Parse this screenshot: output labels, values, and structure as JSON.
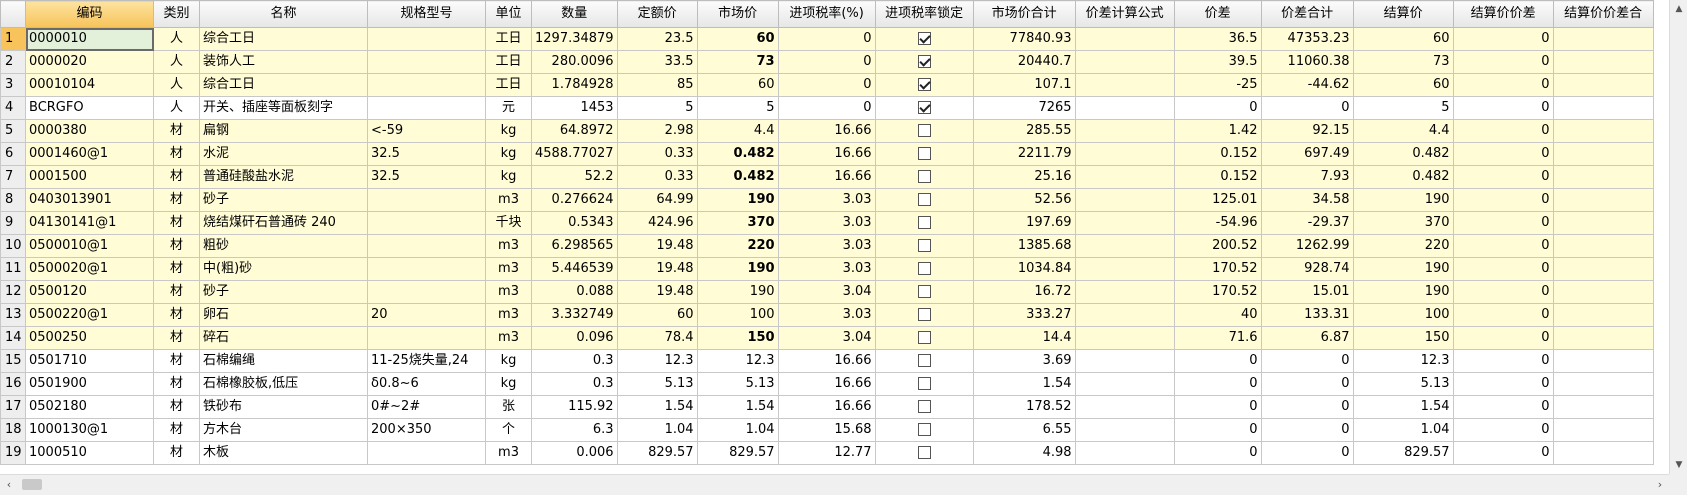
{
  "columns": [
    "",
    "编码",
    "类别",
    "名称",
    "规格型号",
    "单位",
    "数量",
    "定额价",
    "市场价",
    "进项税率(%)",
    "进项税率锁定",
    "市场价合计",
    "价差计算公式",
    "价差",
    "价差合计",
    "结算价",
    "结算价价差",
    "结算价价差合"
  ],
  "sorted_column": 1,
  "rows": [
    {
      "n": "1",
      "code": "0000010",
      "cat": "人",
      "name": "综合工日",
      "spec": "",
      "unit": "工日",
      "qty": "1297.34879",
      "quota": "23.5",
      "market": "60",
      "mb": true,
      "tax": "0",
      "lock": true,
      "mtotal": "77840.93",
      "formula": "",
      "diff": "36.5",
      "difftotal": "47353.23",
      "settle": "60",
      "sdiff": "0",
      "sdifftotal": "",
      "bg": "yellow"
    },
    {
      "n": "2",
      "code": "0000020",
      "cat": "人",
      "name": "装饰人工",
      "spec": "",
      "unit": "工日",
      "qty": "280.0096",
      "quota": "33.5",
      "market": "73",
      "mb": true,
      "tax": "0",
      "lock": true,
      "mtotal": "20440.7",
      "formula": "",
      "diff": "39.5",
      "difftotal": "11060.38",
      "settle": "73",
      "sdiff": "0",
      "sdifftotal": "",
      "bg": "yellow"
    },
    {
      "n": "3",
      "code": "00010104",
      "cat": "人",
      "name": "综合工日",
      "spec": "",
      "unit": "工日",
      "qty": "1.784928",
      "quota": "85",
      "market": "60",
      "mb": false,
      "tax": "0",
      "lock": true,
      "mtotal": "107.1",
      "formula": "",
      "diff": "-25",
      "difftotal": "-44.62",
      "settle": "60",
      "sdiff": "0",
      "sdifftotal": "",
      "bg": "yellow"
    },
    {
      "n": "4",
      "code": "BCRGFO",
      "cat": "人",
      "name": "开关、插座等面板刻字",
      "spec": "",
      "unit": "元",
      "qty": "1453",
      "quota": "5",
      "market": "5",
      "mb": false,
      "tax": "0",
      "lock": true,
      "mtotal": "7265",
      "formula": "",
      "diff": "0",
      "difftotal": "0",
      "settle": "5",
      "sdiff": "0",
      "sdifftotal": "",
      "bg": "white"
    },
    {
      "n": "5",
      "code": "0000380",
      "cat": "材",
      "name": "扁钢",
      "spec": "<-59",
      "unit": "kg",
      "qty": "64.8972",
      "quota": "2.98",
      "market": "4.4",
      "mb": false,
      "tax": "16.66",
      "lock": false,
      "mtotal": "285.55",
      "formula": "",
      "diff": "1.42",
      "difftotal": "92.15",
      "settle": "4.4",
      "sdiff": "0",
      "sdifftotal": "",
      "bg": "yellow"
    },
    {
      "n": "6",
      "code": "0001460@1",
      "cat": "材",
      "name": "水泥",
      "spec": "32.5",
      "unit": "kg",
      "qty": "4588.77027",
      "quota": "0.33",
      "market": "0.482",
      "mb": true,
      "tax": "16.66",
      "lock": false,
      "mtotal": "2211.79",
      "formula": "",
      "diff": "0.152",
      "difftotal": "697.49",
      "settle": "0.482",
      "sdiff": "0",
      "sdifftotal": "",
      "bg": "yellow"
    },
    {
      "n": "7",
      "code": "0001500",
      "cat": "材",
      "name": "普通硅酸盐水泥",
      "spec": "32.5",
      "unit": "kg",
      "qty": "52.2",
      "quota": "0.33",
      "market": "0.482",
      "mb": true,
      "tax": "16.66",
      "lock": false,
      "mtotal": "25.16",
      "formula": "",
      "diff": "0.152",
      "difftotal": "7.93",
      "settle": "0.482",
      "sdiff": "0",
      "sdifftotal": "",
      "bg": "yellow"
    },
    {
      "n": "8",
      "code": "0403013901",
      "cat": "材",
      "name": "砂子",
      "spec": "",
      "unit": "m3",
      "qty": "0.276624",
      "quota": "64.99",
      "market": "190",
      "mb": true,
      "tax": "3.03",
      "lock": false,
      "mtotal": "52.56",
      "formula": "",
      "diff": "125.01",
      "difftotal": "34.58",
      "settle": "190",
      "sdiff": "0",
      "sdifftotal": "",
      "bg": "yellow"
    },
    {
      "n": "9",
      "code": "04130141@1",
      "cat": "材",
      "name": "烧结煤矸石普通砖 240",
      "spec": "",
      "unit": "千块",
      "qty": "0.5343",
      "quota": "424.96",
      "market": "370",
      "mb": true,
      "tax": "3.03",
      "lock": false,
      "mtotal": "197.69",
      "formula": "",
      "diff": "-54.96",
      "difftotal": "-29.37",
      "settle": "370",
      "sdiff": "0",
      "sdifftotal": "",
      "bg": "yellow"
    },
    {
      "n": "10",
      "code": "0500010@1",
      "cat": "材",
      "name": "粗砂",
      "spec": "",
      "unit": "m3",
      "qty": "6.298565",
      "quota": "19.48",
      "market": "220",
      "mb": true,
      "tax": "3.03",
      "lock": false,
      "mtotal": "1385.68",
      "formula": "",
      "diff": "200.52",
      "difftotal": "1262.99",
      "settle": "220",
      "sdiff": "0",
      "sdifftotal": "",
      "bg": "yellow"
    },
    {
      "n": "11",
      "code": "0500020@1",
      "cat": "材",
      "name": "中(粗)砂",
      "spec": "",
      "unit": "m3",
      "qty": "5.446539",
      "quota": "19.48",
      "market": "190",
      "mb": true,
      "tax": "3.03",
      "lock": false,
      "mtotal": "1034.84",
      "formula": "",
      "diff": "170.52",
      "difftotal": "928.74",
      "settle": "190",
      "sdiff": "0",
      "sdifftotal": "",
      "bg": "yellow"
    },
    {
      "n": "12",
      "code": "0500120",
      "cat": "材",
      "name": "砂子",
      "spec": "",
      "unit": "m3",
      "qty": "0.088",
      "quota": "19.48",
      "market": "190",
      "mb": false,
      "tax": "3.04",
      "lock": false,
      "mtotal": "16.72",
      "formula": "",
      "diff": "170.52",
      "difftotal": "15.01",
      "settle": "190",
      "sdiff": "0",
      "sdifftotal": "",
      "bg": "yellow"
    },
    {
      "n": "13",
      "code": "0500220@1",
      "cat": "材",
      "name": "卵石",
      "spec": "20",
      "unit": "m3",
      "qty": "3.332749",
      "quota": "60",
      "market": "100",
      "mb": false,
      "tax": "3.03",
      "lock": false,
      "mtotal": "333.27",
      "formula": "",
      "diff": "40",
      "difftotal": "133.31",
      "settle": "100",
      "sdiff": "0",
      "sdifftotal": "",
      "bg": "yellow"
    },
    {
      "n": "14",
      "code": "0500250",
      "cat": "材",
      "name": "碎石",
      "spec": "",
      "unit": "m3",
      "qty": "0.096",
      "quota": "78.4",
      "market": "150",
      "mb": true,
      "tax": "3.04",
      "lock": false,
      "mtotal": "14.4",
      "formula": "",
      "diff": "71.6",
      "difftotal": "6.87",
      "settle": "150",
      "sdiff": "0",
      "sdifftotal": "",
      "bg": "yellow"
    },
    {
      "n": "15",
      "code": "0501710",
      "cat": "材",
      "name": "石棉编绳",
      "spec": "11-25烧失量,24",
      "unit": "kg",
      "qty": "0.3",
      "quota": "12.3",
      "market": "12.3",
      "mb": false,
      "tax": "16.66",
      "lock": false,
      "mtotal": "3.69",
      "formula": "",
      "diff": "0",
      "difftotal": "0",
      "settle": "12.3",
      "sdiff": "0",
      "sdifftotal": "",
      "bg": "white"
    },
    {
      "n": "16",
      "code": "0501900",
      "cat": "材",
      "name": "石棉橡胶板,低压",
      "spec": "δ0.8~6",
      "unit": "kg",
      "qty": "0.3",
      "quota": "5.13",
      "market": "5.13",
      "mb": false,
      "tax": "16.66",
      "lock": false,
      "mtotal": "1.54",
      "formula": "",
      "diff": "0",
      "difftotal": "0",
      "settle": "5.13",
      "sdiff": "0",
      "sdifftotal": "",
      "bg": "white"
    },
    {
      "n": "17",
      "code": "0502180",
      "cat": "材",
      "name": "铁砂布",
      "spec": "0#~2#",
      "unit": "张",
      "qty": "115.92",
      "quota": "1.54",
      "market": "1.54",
      "mb": false,
      "tax": "16.66",
      "lock": false,
      "mtotal": "178.52",
      "formula": "",
      "diff": "0",
      "difftotal": "0",
      "settle": "1.54",
      "sdiff": "0",
      "sdifftotal": "",
      "bg": "white"
    },
    {
      "n": "18",
      "code": "1000130@1",
      "cat": "材",
      "name": "方木台",
      "spec": "200×350",
      "unit": "个",
      "qty": "6.3",
      "quota": "1.04",
      "market": "1.04",
      "mb": false,
      "tax": "15.68",
      "lock": false,
      "mtotal": "6.55",
      "formula": "",
      "diff": "0",
      "difftotal": "0",
      "settle": "1.04",
      "sdiff": "0",
      "sdifftotal": "",
      "bg": "white"
    },
    {
      "n": "19",
      "code": "1000510",
      "cat": "材",
      "name": "木板",
      "spec": "",
      "unit": "m3",
      "qty": "0.006",
      "quota": "829.57",
      "market": "829.57",
      "mb": false,
      "tax": "12.77",
      "lock": false,
      "mtotal": "4.98",
      "formula": "",
      "diff": "0",
      "difftotal": "0",
      "settle": "829.57",
      "sdiff": "0",
      "sdifftotal": "",
      "bg": "white"
    }
  ]
}
